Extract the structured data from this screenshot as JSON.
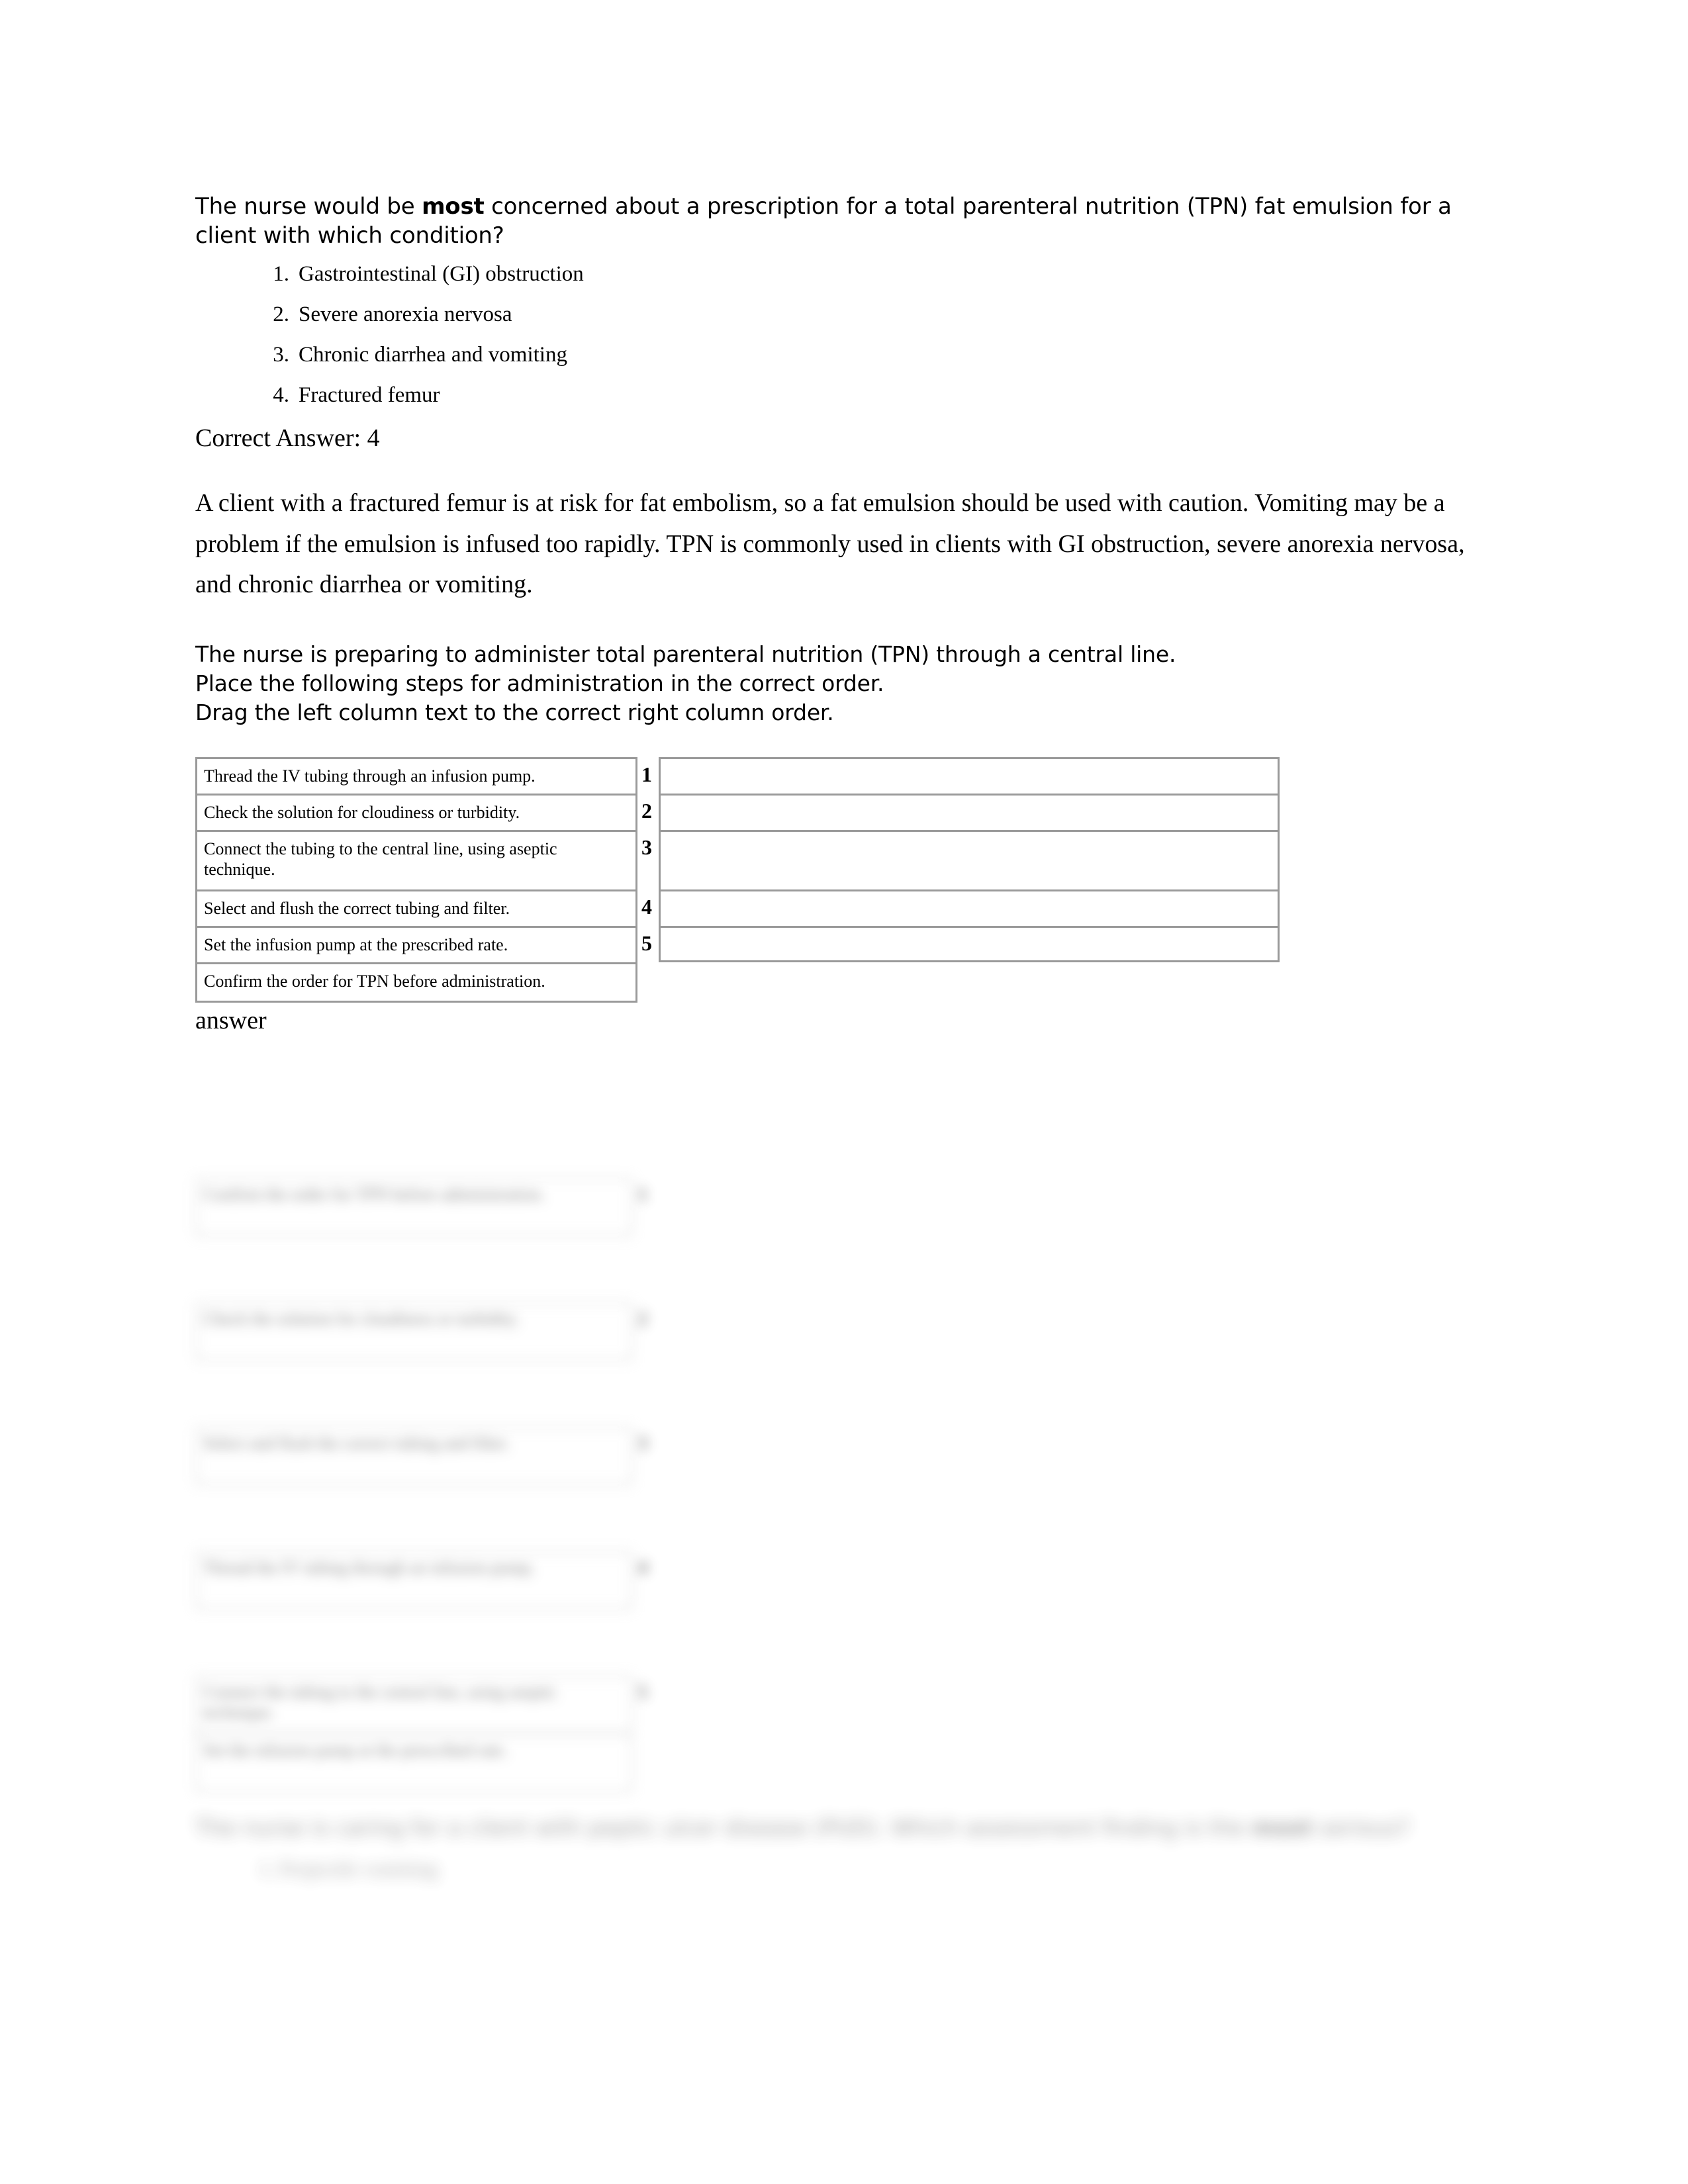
{
  "question1": {
    "stem_before_bold": "The nurse would be ",
    "stem_bold": "most",
    "stem_after_bold": " concerned about a prescription for a total parenteral nutrition (TPN) fat emulsion for a client with which condition?",
    "options": [
      {
        "num": "1.",
        "text": "Gastrointestinal (GI) obstruction"
      },
      {
        "num": "2.",
        "text": "Severe anorexia nervosa"
      },
      {
        "num": "3.",
        "text": "Chronic diarrhea and vomiting"
      },
      {
        "num": "4.",
        "text": "Fractured femur"
      }
    ],
    "correct_answer": "Correct Answer: 4",
    "rationale": "A client with a fractured femur is at risk for fat embolism, so a fat emulsion should be used with caution. Vomiting may be a problem if the emulsion is infused too rapidly. TPN is commonly used in clients with GI obstruction, severe anorexia nervosa, and chronic diarrhea or vomiting."
  },
  "question2": {
    "line1": "The nurse is preparing to administer total parenteral nutrition (TPN) through a central line.",
    "line2": "Place the following steps for administration in the correct order.",
    "line3": "Drag the left column text to the correct right column order.",
    "source_items": [
      "Thread the IV tubing through an infusion pump.",
      "Check the solution for cloudiness or turbidity.",
      "Connect the tubing to the central line, using aseptic technique.",
      "Select and flush the correct tubing and filter.",
      "Set the infusion pump at the prescribed rate.",
      "Confirm the order for TPN before administration."
    ],
    "target_slots": [
      {
        "num": "1",
        "value": ""
      },
      {
        "num": "2",
        "value": ""
      },
      {
        "num": "3",
        "value": ""
      },
      {
        "num": "4",
        "value": ""
      },
      {
        "num": "5",
        "value": ""
      }
    ],
    "answer_label": "answer",
    "answer_key": [
      {
        "num": "1",
        "text": "Confirm the order for TPN before administration."
      },
      {
        "num": "2",
        "text": "Check the solution for cloudiness or turbidity."
      },
      {
        "num": "3",
        "text": "Select and flush the correct tubing and filter."
      },
      {
        "num": "4",
        "text": "Thread the IV tubing through an infusion pump."
      },
      {
        "num": "5",
        "text": "Connect the tubing to the central line, using aseptic technique."
      },
      {
        "num": "",
        "text": "Set the infusion pump at the prescribed rate."
      }
    ]
  },
  "question3_blurred": {
    "stem_before_bold": "The nurse is caring for a client with peptic ulcer disease (PUD). Which assessment finding is the ",
    "stem_bold": "most",
    "stem_after_bold": " serious?",
    "option1": "1. Projectile vomiting"
  }
}
